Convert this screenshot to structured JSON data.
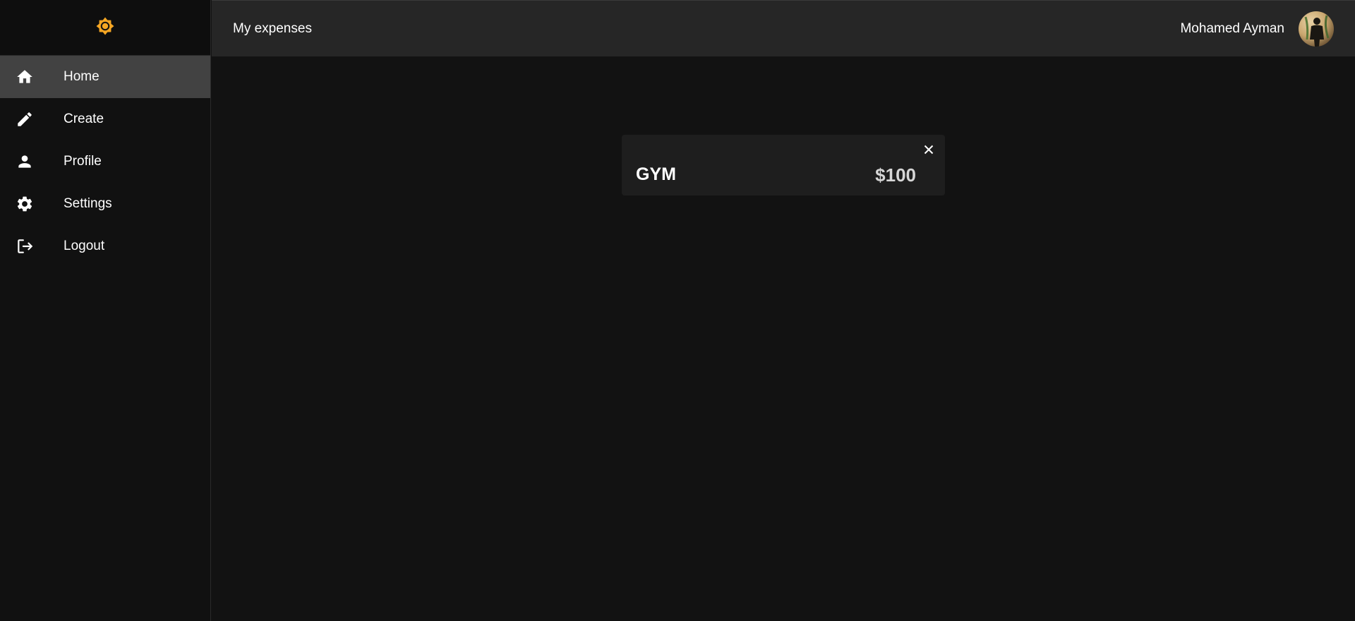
{
  "sidebar": {
    "logo_icon": "brightness-icon",
    "accent_color": "#f5a623",
    "items": [
      {
        "label": "Home",
        "icon": "home-icon",
        "active": true
      },
      {
        "label": "Create",
        "icon": "pencil-icon",
        "active": false
      },
      {
        "label": "Profile",
        "icon": "person-icon",
        "active": false
      },
      {
        "label": "Settings",
        "icon": "gear-icon",
        "active": false
      },
      {
        "label": "Logout",
        "icon": "logout-icon",
        "active": false
      }
    ]
  },
  "topbar": {
    "title": "My expenses",
    "user_name": "Mohamed Ayman"
  },
  "expenses": [
    {
      "title": "GYM",
      "amount": "$100"
    }
  ]
}
